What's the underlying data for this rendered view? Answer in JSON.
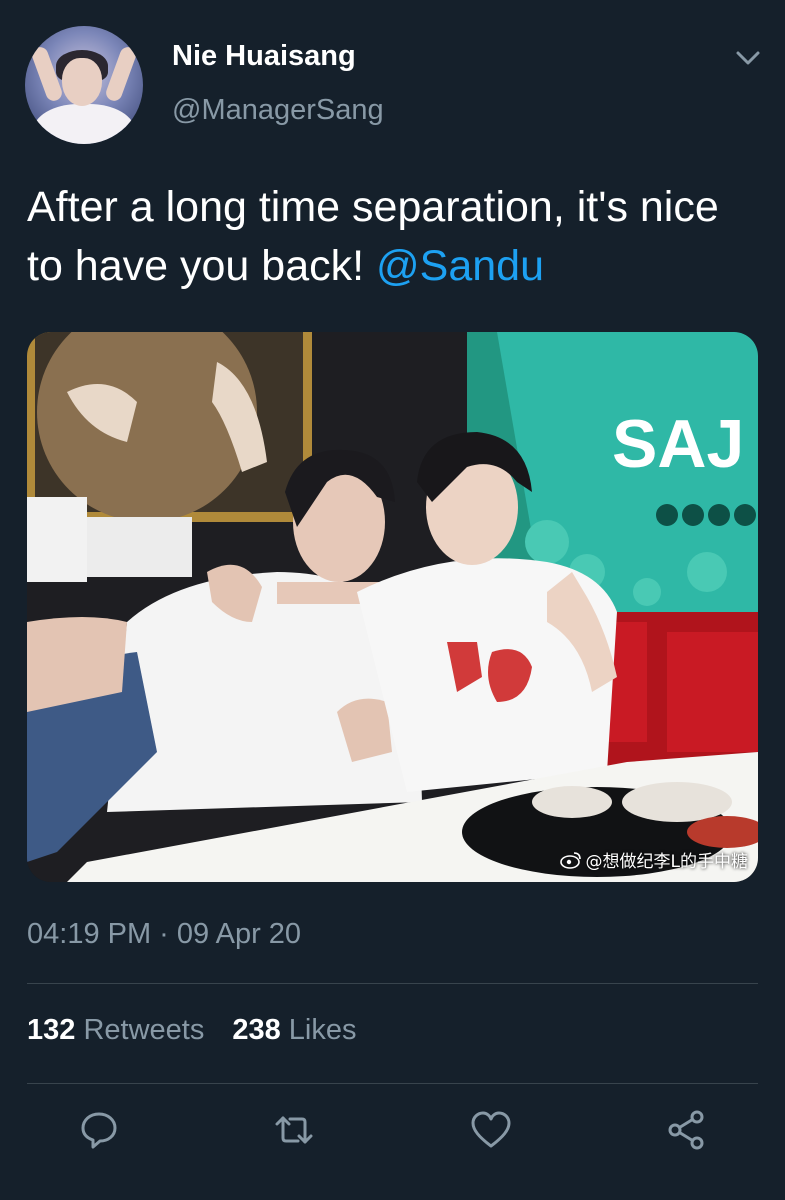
{
  "tweet": {
    "author": {
      "display_name": "Nie Huaisang",
      "handle": "@ManagerSang"
    },
    "text_part1": "After a long time separation, it's nice to have you back! ",
    "mention": "@Sandu",
    "image": {
      "sign_text": "SAJ",
      "watermark": "@想做纪李L的手中糖"
    },
    "timestamp": "04:19 PM · 09 Apr 20",
    "stats": {
      "retweets_count": "132",
      "retweets_label": "Retweets",
      "likes_count": "238",
      "likes_label": "Likes"
    }
  },
  "icons": {
    "caret": "chevron-down-icon",
    "reply": "reply-icon",
    "retweet": "retweet-icon",
    "like": "heart-icon",
    "share": "share-icon",
    "weibo": "weibo-logo-icon"
  },
  "colors": {
    "background": "#15202b",
    "text_primary": "#ffffff",
    "text_secondary": "#8899a6",
    "accent": "#1da1f2",
    "divider": "#38444d"
  }
}
